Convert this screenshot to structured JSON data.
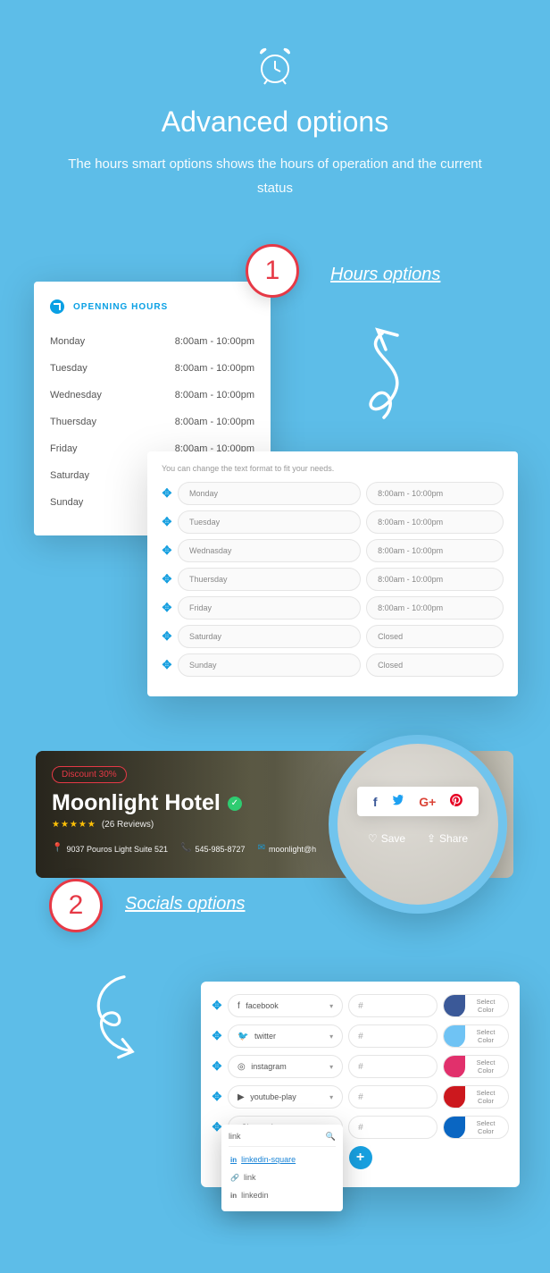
{
  "hero": {
    "title": "Advanced options",
    "subtitle": "The hours smart options shows the hours of operation and the current status"
  },
  "step1": {
    "num": "1",
    "label": "Hours options"
  },
  "hours_card": {
    "title": "OPENNING HOURS",
    "rows": [
      {
        "day": "Monday",
        "time": "8:00am - 10:00pm"
      },
      {
        "day": "Tuesday",
        "time": "8:00am - 10:00pm"
      },
      {
        "day": "Wednesday",
        "time": "8:00am - 10:00pm"
      },
      {
        "day": "Thuersday",
        "time": "8:00am - 10:00pm"
      },
      {
        "day": "Friday",
        "time": "8:00am - 10:00pm"
      },
      {
        "day": "Saturday",
        "time": ""
      },
      {
        "day": "Sunday",
        "time": ""
      }
    ]
  },
  "hours_edit": {
    "note": "You can change the text format to fit your needs.",
    "rows": [
      {
        "day": "Monday",
        "time": "8:00am - 10:00pm"
      },
      {
        "day": "Tuesday",
        "time": "8:00am - 10:00pm"
      },
      {
        "day": "Wednasday",
        "time": "8:00am - 10:00pm"
      },
      {
        "day": "Thuersday",
        "time": "8:00am - 10:00pm"
      },
      {
        "day": "Friday",
        "time": "8:00am - 10:00pm"
      },
      {
        "day": "Saturday",
        "time": "Closed"
      },
      {
        "day": "Sunday",
        "time": "Closed"
      }
    ]
  },
  "banner": {
    "tag": "Discount 30%",
    "title": "Moonlight Hotel",
    "stars": "★★★★★",
    "reviews": "(26 Reviews)",
    "address": "9037 Pouros Light Suite 521",
    "phone": "545-985-8727",
    "email": "moonlight@h"
  },
  "share": {
    "save": "Save",
    "share": "Share"
  },
  "step2": {
    "num": "2",
    "label": "Socials options"
  },
  "socials": {
    "rows": [
      {
        "icon": "f",
        "name": "facebook",
        "url": "#",
        "color": "#3b5998",
        "lab": "Select Color"
      },
      {
        "icon": "🐦",
        "name": "twitter",
        "url": "#",
        "color": "#6fc3f4",
        "lab": "Select Color"
      },
      {
        "icon": "◎",
        "name": "instagram",
        "url": "#",
        "color": "#e1306c",
        "lab": "Select Color"
      },
      {
        "icon": "▶",
        "name": "youtube-play",
        "url": "#",
        "color": "#cc181e",
        "lab": "Select Color"
      },
      {
        "icon": "",
        "name": "Choose Icon",
        "url": "#",
        "color": "#0a66c2",
        "lab": "Select Color"
      }
    ]
  },
  "icon_dd": {
    "search": "link",
    "opts": [
      {
        "icon": "in",
        "label": "linkedin-square",
        "sel": true
      },
      {
        "icon": "🔗",
        "label": "link",
        "sel": false
      },
      {
        "icon": "in",
        "label": "linkedin",
        "sel": false
      }
    ]
  }
}
